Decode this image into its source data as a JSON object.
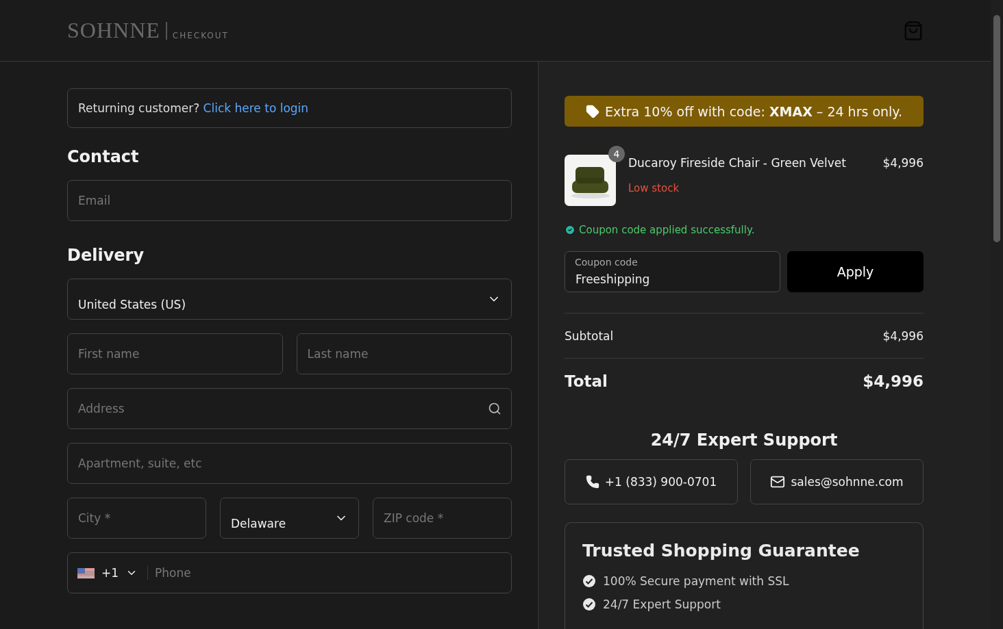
{
  "header": {
    "brand": "SOHNNE",
    "subtitle": "CHECKOUT"
  },
  "login": {
    "prompt": "Returning customer?",
    "link": "Click here to login"
  },
  "contact": {
    "heading": "Contact",
    "email": {
      "placeholder": "Email"
    }
  },
  "delivery": {
    "heading": "Delivery",
    "country": {
      "value": "United States (US)"
    },
    "first_name": {
      "placeholder": "First name"
    },
    "last_name": {
      "placeholder": "Last name"
    },
    "address": {
      "placeholder": "Address"
    },
    "apartment": {
      "placeholder": "Apartment, suite, etc"
    },
    "city": {
      "placeholder": "City *"
    },
    "state": {
      "value": "Delaware"
    },
    "zip": {
      "placeholder": "ZIP code *"
    },
    "phone": {
      "code": "+1",
      "placeholder": "Phone"
    }
  },
  "promo": {
    "text": "Extra 10% off with code: **XMAX** – 24 hrs only."
  },
  "item": {
    "quantity": "4",
    "name": "Ducaroy Fireside Chair - Green Velvet",
    "price": "$4,996",
    "stock": "Low stock"
  },
  "coupon": {
    "message": "Coupon code applied successfully.",
    "label": "Coupon code",
    "value": "Freeshipping",
    "button": "Apply"
  },
  "summary": {
    "subtotal_label": "Subtotal",
    "subtotal": "$4,996",
    "total_label": "Total",
    "total": "$4,996"
  },
  "support": {
    "heading": "24/7 Expert Support",
    "phone": "+1 (833) 900-0701",
    "email": "sales@sohnne.com"
  },
  "guarantee": {
    "heading": "Trusted Shopping Guarantee",
    "items": [
      "100% Secure payment with SSL",
      "24/7 Expert Support"
    ]
  }
}
